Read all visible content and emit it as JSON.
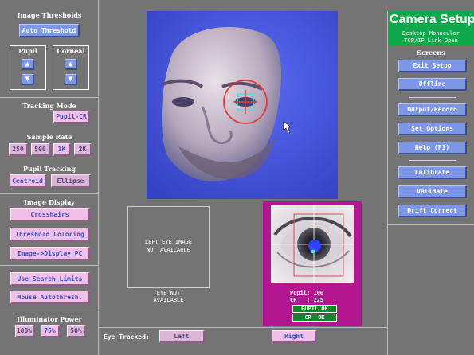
{
  "left": {
    "image_thresholds": {
      "title": "Image Thresholds",
      "auto_threshold": "Auto Threshold",
      "pupil": "Pupil",
      "corneal": "Corneal",
      "up": "▲",
      "down": "▼"
    },
    "tracking_mode": {
      "title": "Tracking Mode",
      "button": "Pupil-CR"
    },
    "sample_rate": {
      "title": "Sample Rate",
      "options": [
        "250",
        "500",
        "1K",
        "2K"
      ],
      "selected": "1K"
    },
    "pupil_tracking": {
      "title": "Pupil Tracking",
      "centroid": "Centroid",
      "ellipse": "Ellipse"
    },
    "image_display": {
      "title": "Image Display",
      "crosshairs": "Crosshairs",
      "threshold_coloring": "Threshold Coloring",
      "image_display_pc": "Image->Display PC"
    },
    "search": {
      "use_search_limits": "Use Search Limits",
      "mouse_autothresh": "Mouse Autothresh."
    },
    "illuminator": {
      "title": "Illuminator Power",
      "options": [
        "100%",
        "75%",
        "50%"
      ],
      "selected": "75%"
    }
  },
  "center": {
    "left_eye_text": "LEFT EYE IMAGE\nNOT AVAILABLE",
    "eye_not_available": "EYE NOT\nAVAILABLE",
    "pupil_readout": "Pupil: 100",
    "cr_readout": "CR   : 225",
    "pupil_ok": "PUPIL OK",
    "cr_ok": "CR  OK",
    "eye_tracked_label": "Eye Tracked:",
    "left_button": "Left",
    "right_button": "Right"
  },
  "right": {
    "title": "Camera Setup",
    "subtitle_1": "Desktop Monocular",
    "subtitle_2": "TCP/IP Link Open",
    "screens_label": "Screens",
    "exit_setup": "Exit Setup",
    "offline": "Offline",
    "output_record": "Output/Record",
    "set_options": "Set Options",
    "help": "Help (F1)",
    "calibrate": "Calibrate",
    "validate": "Validate",
    "drift_correct": "Drift Correct"
  },
  "colors": {
    "panel_bg": "#747474",
    "button_pink": "#f2bfe9",
    "button_blue": "#7d97e8",
    "title_green": "#0fa84a",
    "status_green": "#0e8a22",
    "eye_frame_magenta": "#b3178f",
    "camera_blue": "#3f51d9"
  }
}
